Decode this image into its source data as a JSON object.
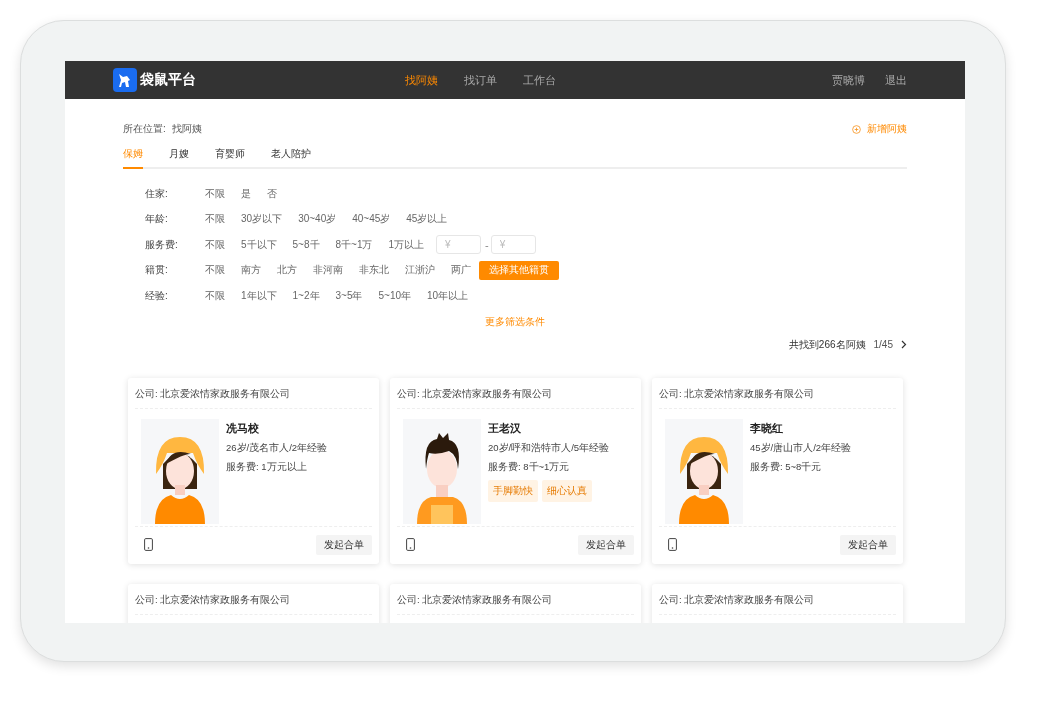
{
  "header": {
    "logo_text": "袋鼠平台",
    "nav": [
      {
        "label": "找阿姨",
        "selected": true
      },
      {
        "label": "找订单",
        "selected": false
      },
      {
        "label": "工作台",
        "selected": false
      }
    ],
    "user": "贾晓博",
    "logout": "退出"
  },
  "breadcrumb": {
    "label": "所在位置:",
    "current": "找阿姨"
  },
  "add_button": "新增阿姨",
  "tabs": [
    {
      "label": "保姆",
      "selected": true
    },
    {
      "label": "月嫂",
      "selected": false
    },
    {
      "label": "育婴师",
      "selected": false
    },
    {
      "label": "老人陪护",
      "selected": false
    }
  ],
  "filters": [
    {
      "label": "住家:",
      "options": [
        "不限",
        "是",
        "否"
      ]
    },
    {
      "label": "年龄:",
      "options": [
        "不限",
        "30岁以下",
        "30~40岁",
        "40~45岁",
        "45岁以上"
      ]
    },
    {
      "label": "服务费:",
      "options": [
        "不限",
        "5千以下",
        "5~8千",
        "8千~1万",
        "1万以上"
      ],
      "range": {
        "min_placeholder": "¥",
        "separator": "-",
        "max_placeholder": "¥"
      }
    },
    {
      "label": "籍贯:",
      "options": [
        "不限",
        "南方",
        "北方",
        "非河南",
        "非东北",
        "江浙沪",
        "两广"
      ],
      "button": "选择其他籍贯"
    },
    {
      "label": "经验:",
      "options": [
        "不限",
        "1年以下",
        "1~2年",
        "3~5年",
        "5~10年",
        "10年以上"
      ]
    }
  ],
  "more_filters": "更多筛选条件",
  "result": {
    "count": "共找到266名阿姨",
    "page": "1/45"
  },
  "cards": [
    {
      "company": "公司: 北京爱浓情家政服务有限公司",
      "kind": "female",
      "name": "冼马校",
      "info": "26岁/茂名市人/2年经验",
      "fee": "服务费: 1万元以上",
      "action": "发起合单"
    },
    {
      "company": "公司: 北京爱浓情家政服务有限公司",
      "kind": "male",
      "name": "王老汉",
      "info": "20岁/呼和浩特市人/5年经验",
      "fee": "服务费: 8千~1万元",
      "tags": [
        "手脚勤快",
        "细心认真"
      ],
      "action": "发起合单"
    },
    {
      "company": "公司: 北京爱浓情家政服务有限公司",
      "kind": "female",
      "name": "李晓红",
      "info": "45岁/唐山市人/2年经验",
      "fee": "服务费: 5~8千元",
      "action": "发起合单"
    },
    {
      "company": "公司: 北京爱浓情家政服务有限公司"
    },
    {
      "company": "公司: 北京爱浓情家政服务有限公司"
    },
    {
      "company": "公司: 北京爱浓情家政服务有限公司"
    }
  ]
}
